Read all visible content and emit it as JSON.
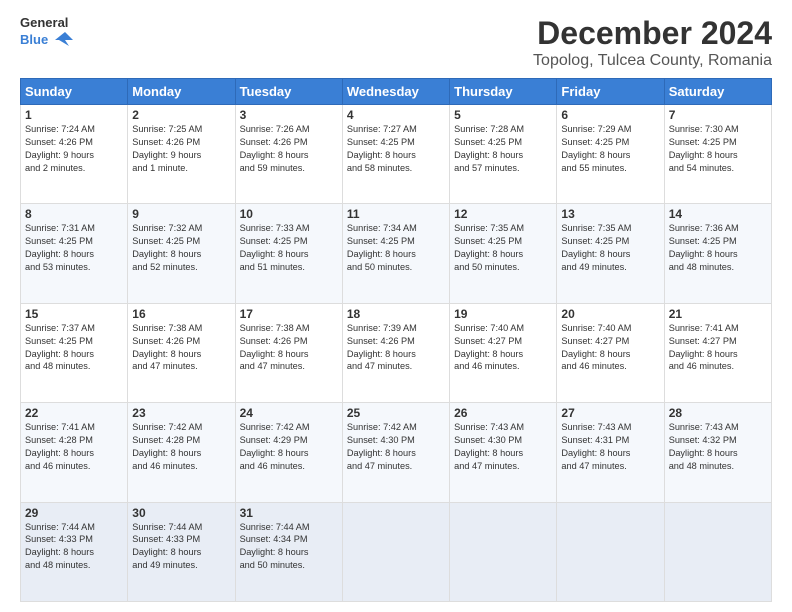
{
  "header": {
    "logo_line1": "General",
    "logo_line2": "Blue",
    "title": "December 2024",
    "subtitle": "Topolog, Tulcea County, Romania"
  },
  "columns": [
    "Sunday",
    "Monday",
    "Tuesday",
    "Wednesday",
    "Thursday",
    "Friday",
    "Saturday"
  ],
  "weeks": [
    [
      {
        "day": "1",
        "lines": [
          "Sunrise: 7:24 AM",
          "Sunset: 4:26 PM",
          "Daylight: 9 hours",
          "and 2 minutes."
        ]
      },
      {
        "day": "2",
        "lines": [
          "Sunrise: 7:25 AM",
          "Sunset: 4:26 PM",
          "Daylight: 9 hours",
          "and 1 minute."
        ]
      },
      {
        "day": "3",
        "lines": [
          "Sunrise: 7:26 AM",
          "Sunset: 4:26 PM",
          "Daylight: 8 hours",
          "and 59 minutes."
        ]
      },
      {
        "day": "4",
        "lines": [
          "Sunrise: 7:27 AM",
          "Sunset: 4:25 PM",
          "Daylight: 8 hours",
          "and 58 minutes."
        ]
      },
      {
        "day": "5",
        "lines": [
          "Sunrise: 7:28 AM",
          "Sunset: 4:25 PM",
          "Daylight: 8 hours",
          "and 57 minutes."
        ]
      },
      {
        "day": "6",
        "lines": [
          "Sunrise: 7:29 AM",
          "Sunset: 4:25 PM",
          "Daylight: 8 hours",
          "and 55 minutes."
        ]
      },
      {
        "day": "7",
        "lines": [
          "Sunrise: 7:30 AM",
          "Sunset: 4:25 PM",
          "Daylight: 8 hours",
          "and 54 minutes."
        ]
      }
    ],
    [
      {
        "day": "8",
        "lines": [
          "Sunrise: 7:31 AM",
          "Sunset: 4:25 PM",
          "Daylight: 8 hours",
          "and 53 minutes."
        ]
      },
      {
        "day": "9",
        "lines": [
          "Sunrise: 7:32 AM",
          "Sunset: 4:25 PM",
          "Daylight: 8 hours",
          "and 52 minutes."
        ]
      },
      {
        "day": "10",
        "lines": [
          "Sunrise: 7:33 AM",
          "Sunset: 4:25 PM",
          "Daylight: 8 hours",
          "and 51 minutes."
        ]
      },
      {
        "day": "11",
        "lines": [
          "Sunrise: 7:34 AM",
          "Sunset: 4:25 PM",
          "Daylight: 8 hours",
          "and 50 minutes."
        ]
      },
      {
        "day": "12",
        "lines": [
          "Sunrise: 7:35 AM",
          "Sunset: 4:25 PM",
          "Daylight: 8 hours",
          "and 50 minutes."
        ]
      },
      {
        "day": "13",
        "lines": [
          "Sunrise: 7:35 AM",
          "Sunset: 4:25 PM",
          "Daylight: 8 hours",
          "and 49 minutes."
        ]
      },
      {
        "day": "14",
        "lines": [
          "Sunrise: 7:36 AM",
          "Sunset: 4:25 PM",
          "Daylight: 8 hours",
          "and 48 minutes."
        ]
      }
    ],
    [
      {
        "day": "15",
        "lines": [
          "Sunrise: 7:37 AM",
          "Sunset: 4:25 PM",
          "Daylight: 8 hours",
          "and 48 minutes."
        ]
      },
      {
        "day": "16",
        "lines": [
          "Sunrise: 7:38 AM",
          "Sunset: 4:26 PM",
          "Daylight: 8 hours",
          "and 47 minutes."
        ]
      },
      {
        "day": "17",
        "lines": [
          "Sunrise: 7:38 AM",
          "Sunset: 4:26 PM",
          "Daylight: 8 hours",
          "and 47 minutes."
        ]
      },
      {
        "day": "18",
        "lines": [
          "Sunrise: 7:39 AM",
          "Sunset: 4:26 PM",
          "Daylight: 8 hours",
          "and 47 minutes."
        ]
      },
      {
        "day": "19",
        "lines": [
          "Sunrise: 7:40 AM",
          "Sunset: 4:27 PM",
          "Daylight: 8 hours",
          "and 46 minutes."
        ]
      },
      {
        "day": "20",
        "lines": [
          "Sunrise: 7:40 AM",
          "Sunset: 4:27 PM",
          "Daylight: 8 hours",
          "and 46 minutes."
        ]
      },
      {
        "day": "21",
        "lines": [
          "Sunrise: 7:41 AM",
          "Sunset: 4:27 PM",
          "Daylight: 8 hours",
          "and 46 minutes."
        ]
      }
    ],
    [
      {
        "day": "22",
        "lines": [
          "Sunrise: 7:41 AM",
          "Sunset: 4:28 PM",
          "Daylight: 8 hours",
          "and 46 minutes."
        ]
      },
      {
        "day": "23",
        "lines": [
          "Sunrise: 7:42 AM",
          "Sunset: 4:28 PM",
          "Daylight: 8 hours",
          "and 46 minutes."
        ]
      },
      {
        "day": "24",
        "lines": [
          "Sunrise: 7:42 AM",
          "Sunset: 4:29 PM",
          "Daylight: 8 hours",
          "and 46 minutes."
        ]
      },
      {
        "day": "25",
        "lines": [
          "Sunrise: 7:42 AM",
          "Sunset: 4:30 PM",
          "Daylight: 8 hours",
          "and 47 minutes."
        ]
      },
      {
        "day": "26",
        "lines": [
          "Sunrise: 7:43 AM",
          "Sunset: 4:30 PM",
          "Daylight: 8 hours",
          "and 47 minutes."
        ]
      },
      {
        "day": "27",
        "lines": [
          "Sunrise: 7:43 AM",
          "Sunset: 4:31 PM",
          "Daylight: 8 hours",
          "and 47 minutes."
        ]
      },
      {
        "day": "28",
        "lines": [
          "Sunrise: 7:43 AM",
          "Sunset: 4:32 PM",
          "Daylight: 8 hours",
          "and 48 minutes."
        ]
      }
    ],
    [
      {
        "day": "29",
        "lines": [
          "Sunrise: 7:44 AM",
          "Sunset: 4:33 PM",
          "Daylight: 8 hours",
          "and 48 minutes."
        ]
      },
      {
        "day": "30",
        "lines": [
          "Sunrise: 7:44 AM",
          "Sunset: 4:33 PM",
          "Daylight: 8 hours",
          "and 49 minutes."
        ]
      },
      {
        "day": "31",
        "lines": [
          "Sunrise: 7:44 AM",
          "Sunset: 4:34 PM",
          "Daylight: 8 hours",
          "and 50 minutes."
        ]
      },
      {
        "day": "",
        "lines": []
      },
      {
        "day": "",
        "lines": []
      },
      {
        "day": "",
        "lines": []
      },
      {
        "day": "",
        "lines": []
      }
    ]
  ]
}
